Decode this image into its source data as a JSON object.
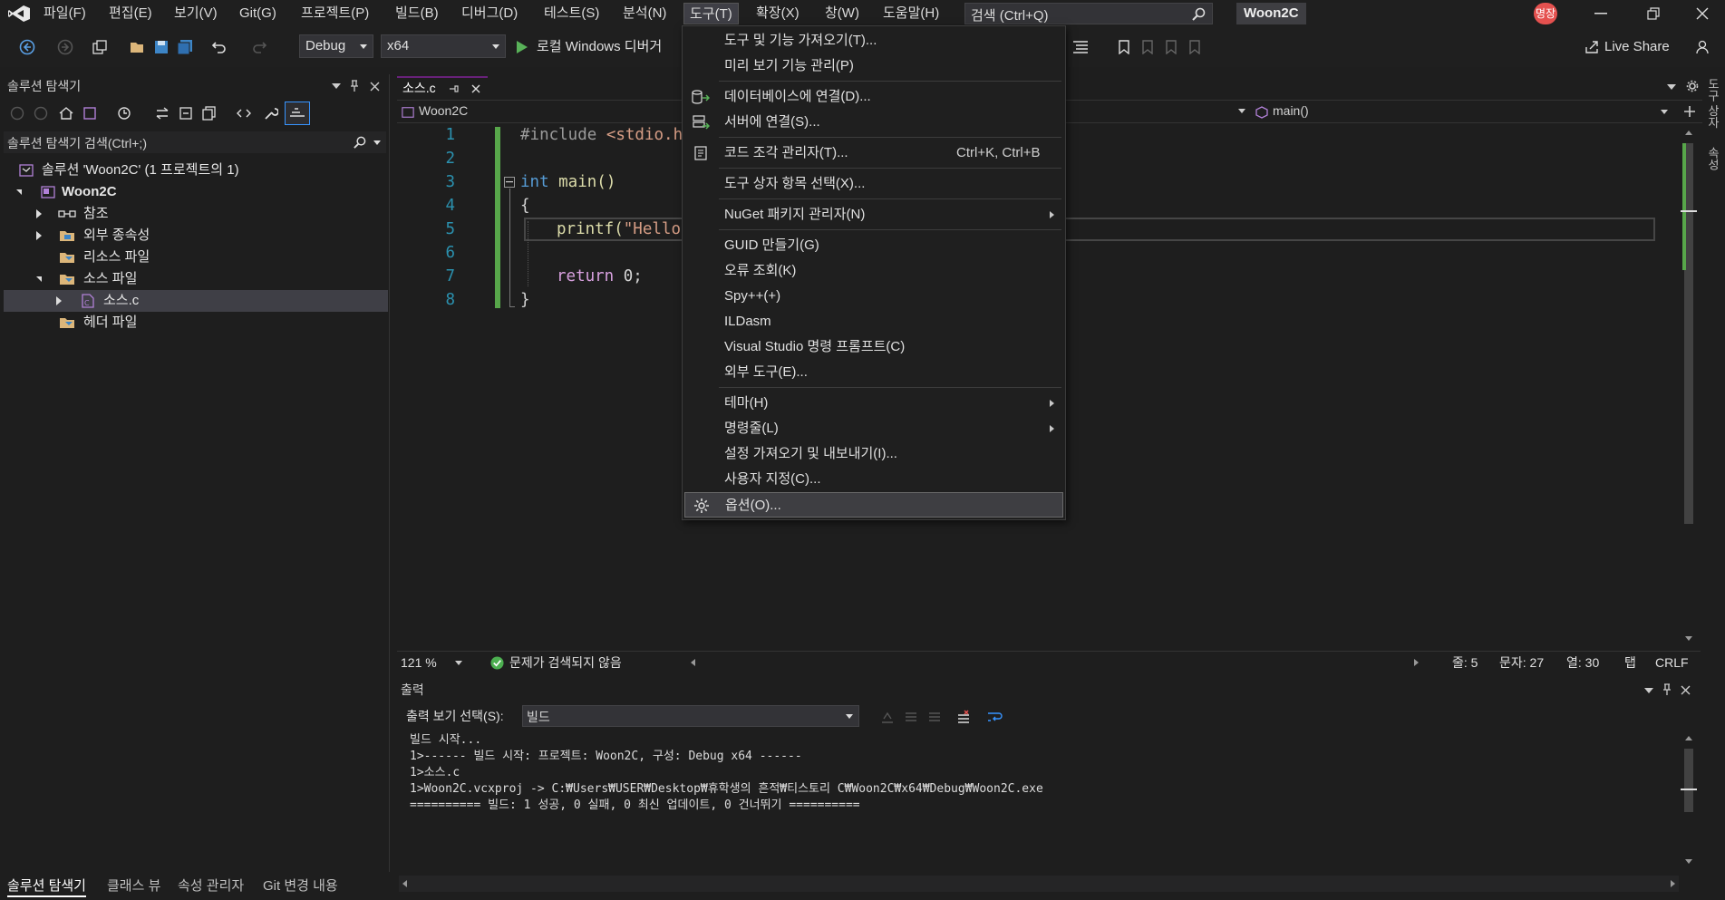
{
  "menubar": {
    "items": [
      "파일(F)",
      "편집(E)",
      "보기(V)",
      "Git(G)",
      "프로젝트(P)",
      "빌드(B)",
      "디버그(D)",
      "테스트(S)",
      "분석(N)",
      "도구(T)",
      "확장(X)",
      "창(W)",
      "도움말(H)"
    ],
    "search_placeholder": "검색 (Ctrl+Q)",
    "solution_name": "Woon2C",
    "user_badge": "명장"
  },
  "toolbar": {
    "config": "Debug",
    "platform": "x64",
    "run_label": "로컬 Windows 디버거",
    "live_share": "Live Share"
  },
  "solution_explorer": {
    "title": "솔루션 탐색기",
    "search_placeholder": "솔루션 탐색기 검색(Ctrl+;)",
    "tree": [
      "솔루션 'Woon2C' (1 프로젝트의 1)",
      "Woon2C",
      "참조",
      "외부 종속성",
      "리소스 파일",
      "소스 파일",
      "소스.c",
      "헤더 파일"
    ]
  },
  "editor": {
    "tab_label": "소스.c",
    "nav_project": "Woon2C",
    "nav_member": "main()",
    "line_numbers": [
      "1",
      "2",
      "3",
      "4",
      "5",
      "6",
      "7",
      "8"
    ],
    "code": {
      "l1_include": "#include ",
      "l1_header": "<stdio.h>",
      "l3_kw": "int",
      "l3_rest": " main()",
      "l4": "{",
      "l5_fn": "printf(",
      "l5_str": "\"Hello W",
      "l7_kw": "return",
      "l7_rest": " 0;",
      "l8": "}"
    },
    "zoom": "121 %",
    "issues": "문제가 검색되지 않음",
    "line": "줄: 5",
    "char": "문자: 27",
    "col": "열: 30",
    "tab": "탭",
    "eol": "CRLF"
  },
  "output": {
    "title": "출력",
    "source_label": "출력 보기 선택(S):",
    "source_value": "빌드",
    "lines": [
      "빌드 시작...",
      "1>------ 빌드 시작: 프로젝트: Woon2C, 구성: Debug x64 ------",
      "1>소스.c",
      "1>Woon2C.vcxproj -> C:₩Users₩USER₩Desktop₩휴학생의 흔적₩티스토리 C₩Woon2C₩x64₩Debug₩Woon2C.exe",
      "========== 빌드: 1 성공, 0 실패, 0 최신 업데이트, 0 건너뛰기 =========="
    ]
  },
  "tools_menu": {
    "items": [
      {
        "label": "도구 및 기능 가져오기(T)...",
        "shortcut": ""
      },
      {
        "label": "미리 보기 기능 관리(P)",
        "shortcut": ""
      },
      {
        "label": "데이터베이스에 연결(D)...",
        "shortcut": ""
      },
      {
        "label": "서버에 연결(S)...",
        "shortcut": ""
      },
      {
        "label": "코드 조각 관리자(T)...",
        "shortcut": "Ctrl+K, Ctrl+B"
      },
      {
        "label": "도구 상자 항목 선택(X)...",
        "shortcut": ""
      },
      {
        "label": "NuGet 패키지 관리자(N)",
        "shortcut": ""
      },
      {
        "label": "GUID 만들기(G)",
        "shortcut": ""
      },
      {
        "label": "오류 조회(K)",
        "shortcut": ""
      },
      {
        "label": "Spy++(+)",
        "shortcut": ""
      },
      {
        "label": "ILDasm",
        "shortcut": ""
      },
      {
        "label": "Visual Studio 명령 프롬프트(C)",
        "shortcut": ""
      },
      {
        "label": "외부 도구(E)...",
        "shortcut": ""
      },
      {
        "label": "테마(H)",
        "shortcut": ""
      },
      {
        "label": "명령줄(L)",
        "shortcut": ""
      },
      {
        "label": "설정 가져오기 및 내보내기(I)...",
        "shortcut": ""
      },
      {
        "label": "사용자 지정(C)...",
        "shortcut": ""
      },
      {
        "label": "옵션(O)...",
        "shortcut": ""
      }
    ]
  },
  "bottom_tabs": [
    "솔루션 탐색기",
    "클래스 뷰",
    "속성 관리자",
    "Git 변경 내용"
  ],
  "right_strip": [
    "도구 상자",
    "속성"
  ],
  "colors": {
    "accent": "#68217a",
    "keyword": "#569cd6",
    "string": "#d69d85",
    "function": "#dcdcaa",
    "include": "#9b9b9b",
    "green_bar": "#57a64a",
    "badge": "#e5514f"
  }
}
